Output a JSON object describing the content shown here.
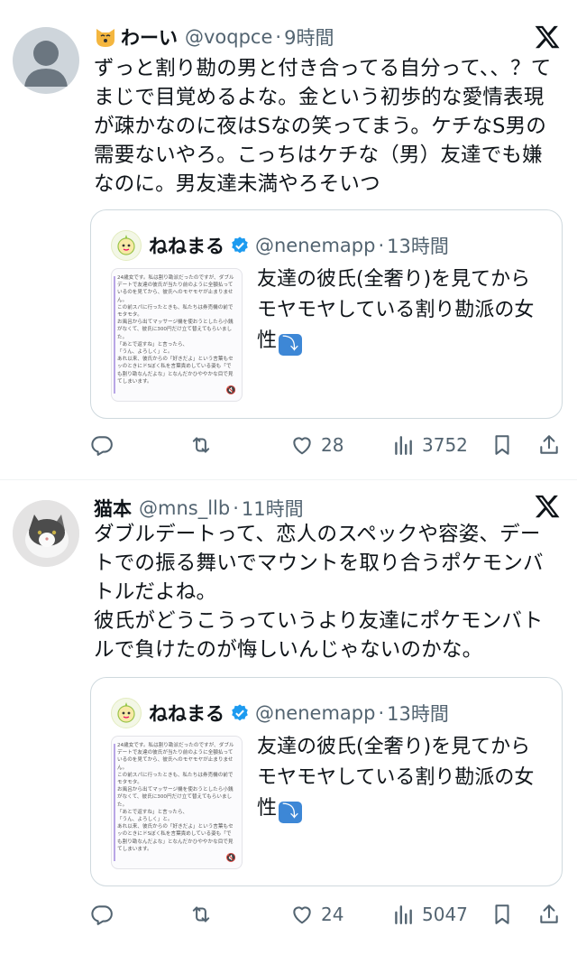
{
  "tweets": [
    {
      "name": "わーい",
      "handle": "@voqpce",
      "time": "9時間",
      "body": [
        "ずっと割り勘の男と付き合ってる自分って、、？てまじで目覚めるよな。金という初歩的な愛情表現が疎かなのに夜はSなの笑ってまう。ケチなS男の需要ないやろ。こっちはケチな（男）友達でも嫌なのに。男友達未満やろそいつ"
      ],
      "quote": {
        "name": "ねねまる",
        "handle": "@nenemapp",
        "time": "13時間",
        "text": "友達の彼氏(全奢り)を見てからモヤモヤしている割り勘派の女性",
        "emoji": "⤵"
      },
      "likes": "28",
      "views": "3752"
    },
    {
      "name": "猫本",
      "handle": "@mns_llb",
      "time": "11時間",
      "body": [
        "ダブルデートって、恋人のスペックや容姿、デートでの振る舞いでマウントを取り合うポケモンバトルだよね。",
        "彼氏がどうこうっていうより友達にポケモンバトルで負けたのが悔しいんじゃないのかな。"
      ],
      "quote": {
        "name": "ねねまる",
        "handle": "@nenemapp",
        "time": "13時間",
        "text": "友達の彼氏(全奢り)を見てからモヤモヤしている割り勘派の女性",
        "emoji": "⤵"
      },
      "likes": "24",
      "views": "5047"
    }
  ],
  "thumb_text": "24歳女です。私は割り勘派だったのですが、ダブルデートで友達の彼氏が当たり前のように全額払っているのを見てから、彼氏へのモヤモヤが止まりません。\nこの前スパに行ったときも、私たちは券売機の前でモタモタ。\nお風呂から出てマッサージ機を使おうとしたら小銭がなくて、彼氏に300円だけ立て替えてもらいました。\n「あとで返すね」と言ったら、\n「うん、よろしく」と。\nあれ以来、彼氏からの「好きだよ」という言葉もセッのときにドSぼく私を言葉責めしている姿も「でも割り勘なんだよな」となんだかひややかな目で見てしまいます。",
  "colors": {
    "text": "#0f1419",
    "muted": "#536471",
    "verified": "#1d9bf0",
    "border": "#cfd9de"
  },
  "icons": [
    "reply-icon",
    "retweet-icon",
    "like-icon",
    "views-icon",
    "bookmark-icon",
    "share-icon",
    "x-logo-icon",
    "verified-badge-icon"
  ]
}
